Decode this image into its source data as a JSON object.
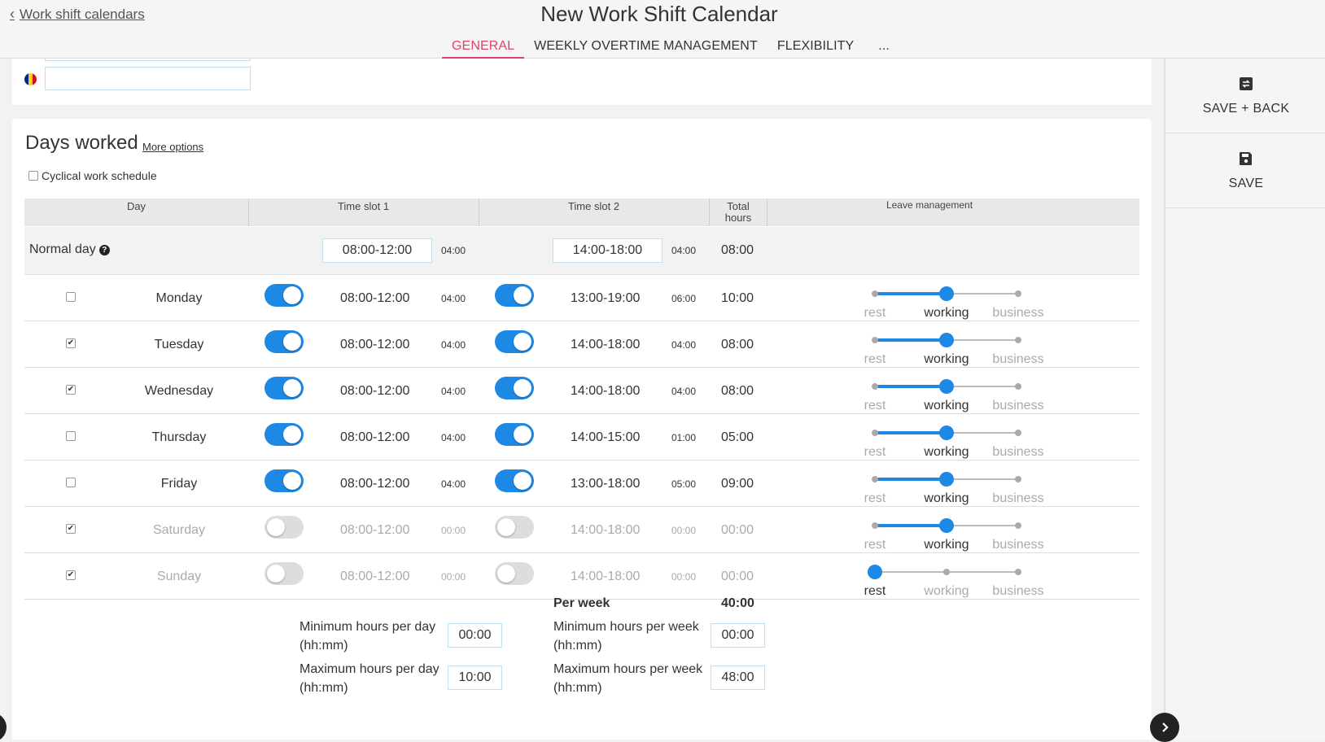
{
  "header": {
    "back_label": "Work shift calendars",
    "title": "New Work Shift Calendar",
    "tabs": [
      "GENERAL",
      "WEEKLY OVERTIME MANAGEMENT",
      "FLEXIBILITY",
      "..."
    ]
  },
  "sidebar": {
    "save_back_label": "SAVE + BACK",
    "save_label": "SAVE"
  },
  "days_worked": {
    "title": "Days worked",
    "more_options": "More options",
    "cyclical_label": "Cyclical work schedule",
    "columns": [
      "Day",
      "Time slot 1",
      "Time slot 2",
      "Total hours",
      "Leave management"
    ],
    "normal_day": {
      "label": "Normal day",
      "slot1": "08:00-12:00",
      "slot1_dur": "04:00",
      "slot2": "14:00-18:00",
      "slot2_dur": "04:00",
      "total": "08:00"
    },
    "leave_labels": [
      "rest",
      "working",
      "business"
    ],
    "days": [
      {
        "name": "Monday",
        "checked": false,
        "on1": true,
        "slot1": "08:00-12:00",
        "dur1": "04:00",
        "on2": true,
        "slot2": "13:00-19:00",
        "dur2": "06:00",
        "total": "10:00",
        "leave": "working"
      },
      {
        "name": "Tuesday",
        "checked": true,
        "on1": true,
        "slot1": "08:00-12:00",
        "dur1": "04:00",
        "on2": true,
        "slot2": "14:00-18:00",
        "dur2": "04:00",
        "total": "08:00",
        "leave": "working"
      },
      {
        "name": "Wednesday",
        "checked": true,
        "on1": true,
        "slot1": "08:00-12:00",
        "dur1": "04:00",
        "on2": true,
        "slot2": "14:00-18:00",
        "dur2": "04:00",
        "total": "08:00",
        "leave": "working"
      },
      {
        "name": "Thursday",
        "checked": false,
        "on1": true,
        "slot1": "08:00-12:00",
        "dur1": "04:00",
        "on2": true,
        "slot2": "14:00-15:00",
        "dur2": "01:00",
        "total": "05:00",
        "leave": "working"
      },
      {
        "name": "Friday",
        "checked": false,
        "on1": true,
        "slot1": "08:00-12:00",
        "dur1": "04:00",
        "on2": true,
        "slot2": "13:00-18:00",
        "dur2": "05:00",
        "total": "09:00",
        "leave": "working"
      },
      {
        "name": "Saturday",
        "checked": true,
        "on1": false,
        "slot1": "08:00-12:00",
        "dur1": "00:00",
        "on2": false,
        "slot2": "14:00-18:00",
        "dur2": "00:00",
        "total": "00:00",
        "leave": "working"
      },
      {
        "name": "Sunday",
        "checked": true,
        "on1": false,
        "slot1": "08:00-12:00",
        "dur1": "00:00",
        "on2": false,
        "slot2": "14:00-18:00",
        "dur2": "00:00",
        "total": "00:00",
        "leave": "rest"
      }
    ],
    "summary": {
      "per_week_label": "Per week",
      "per_week_value": "40:00",
      "min_day_label_1": "Minimum hours per day",
      "min_day_label_2": "(hh:mm)",
      "min_day_value": "00:00",
      "max_day_label_1": "Maximum hours per day",
      "max_day_label_2": "(hh:mm)",
      "max_day_value": "10:00",
      "min_week_label_1": "Minimum hours per week",
      "min_week_label_2": "(hh:mm)",
      "min_week_value": "00:00",
      "max_week_label_1": "Maximum hours per week",
      "max_week_label_2": "(hh:mm)",
      "max_week_value": "48:00"
    }
  },
  "colors": {
    "accent": "#1e88e5",
    "tab_active": "#e0446a"
  }
}
